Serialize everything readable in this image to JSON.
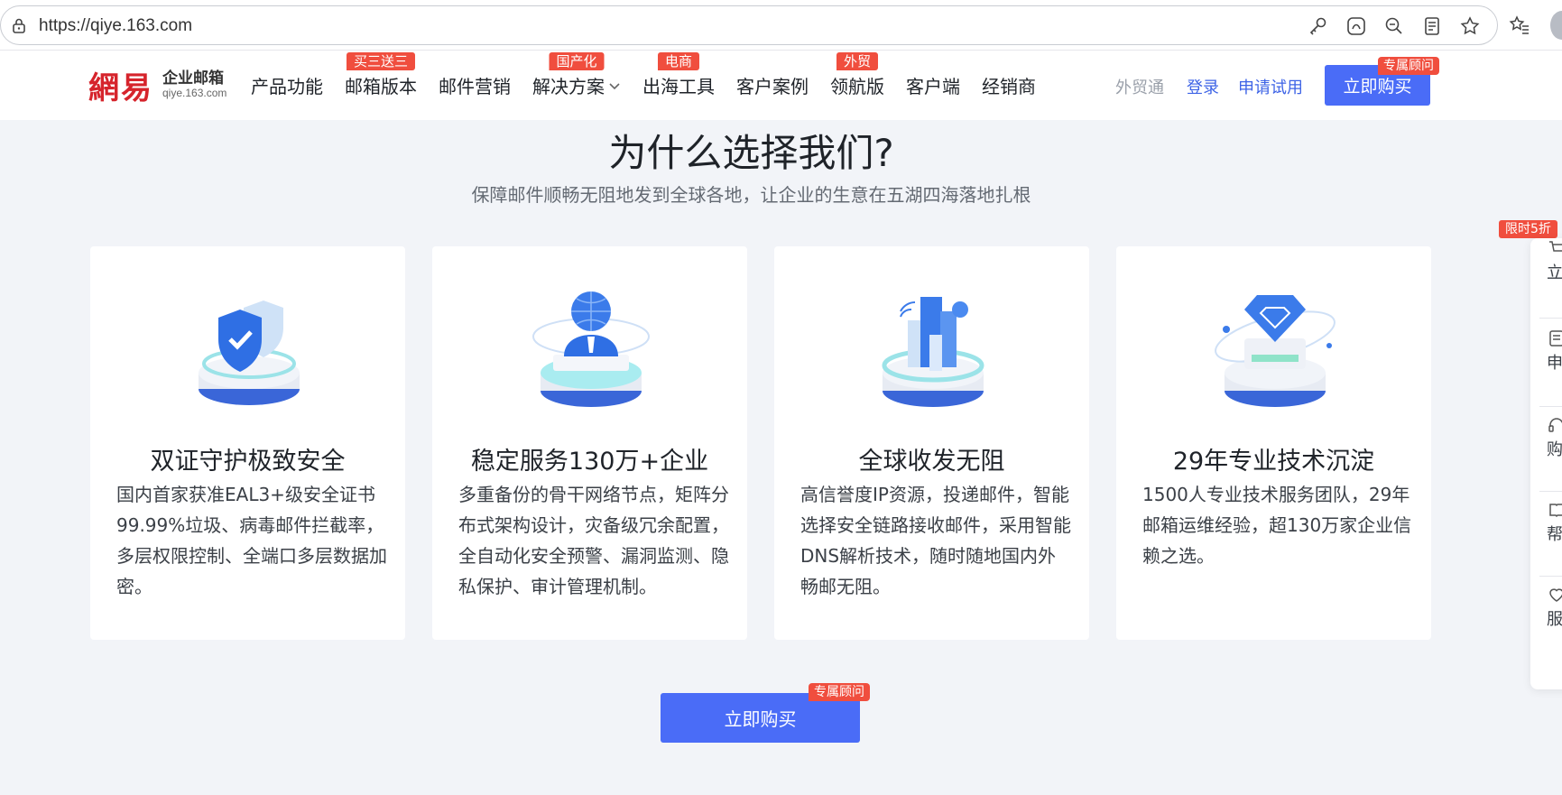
{
  "browser": {
    "url": "https://qiye.163.com"
  },
  "header": {
    "logo_mark": "網易",
    "logo_title": "企业邮箱",
    "logo_domain": "qiye.163.com",
    "nav": [
      {
        "label": "产品功能",
        "badge": ""
      },
      {
        "label": "邮箱版本",
        "badge": "买三送三"
      },
      {
        "label": "邮件营销",
        "badge": ""
      },
      {
        "label": "解决方案",
        "badge": "国产化"
      },
      {
        "label": "出海工具",
        "badge": "电商"
      },
      {
        "label": "客户案例",
        "badge": ""
      },
      {
        "label": "领航版",
        "badge": "外贸"
      },
      {
        "label": "客户端",
        "badge": ""
      },
      {
        "label": "经销商",
        "badge": ""
      }
    ],
    "waimao": "外贸通",
    "login": "登录",
    "trial": "申请试用",
    "buy": "立即购买",
    "buy_tag": "专属顾问"
  },
  "section": {
    "title": "为什么选择我们?",
    "subtitle": "保障邮件顺畅无阻地发到全球各地，让企业的生意在五湖四海落地扎根"
  },
  "cards": [
    {
      "title": "双证守护极致安全",
      "desc": "国内首家获准EAL3+级安全证书99.99%垃圾、病毒邮件拦截率，多层权限控制、全端口多层数据加密。",
      "icon": "shield-icon"
    },
    {
      "title": "稳定服务130万+企业",
      "desc": "多重备份的骨干网络节点，矩阵分布式架构设计，灾备级冗余配置，全自动化安全预警、漏洞监测、隐私保护、审计管理机制。",
      "icon": "globe-person-icon"
    },
    {
      "title": "全球收发无阻",
      "desc": "高信誉度IP资源，投递邮件，智能选择安全链路接收邮件，采用智能DNS解析技术，随时随地国内外畅邮无阻。",
      "icon": "bar-chart-icon"
    },
    {
      "title": "29年专业技术沉淀",
      "desc": "1500人专业技术服务团队，29年邮箱运维经验，超130万家企业信赖之选。",
      "icon": "diamond-icon"
    }
  ],
  "cta": {
    "buy": "立即购买",
    "tag": "专属顾问"
  },
  "sidebar": {
    "tag": "限时5折",
    "items": [
      {
        "label": "立购"
      },
      {
        "label": "申试"
      },
      {
        "label": "购咨"
      },
      {
        "label": "帮中"
      },
      {
        "label": "服优"
      }
    ]
  },
  "colors": {
    "brand_blue": "#4a6cf7",
    "badge_red": "#f04e3e",
    "logo_red": "#d6242c",
    "page_bg": "#f2f4f8"
  }
}
